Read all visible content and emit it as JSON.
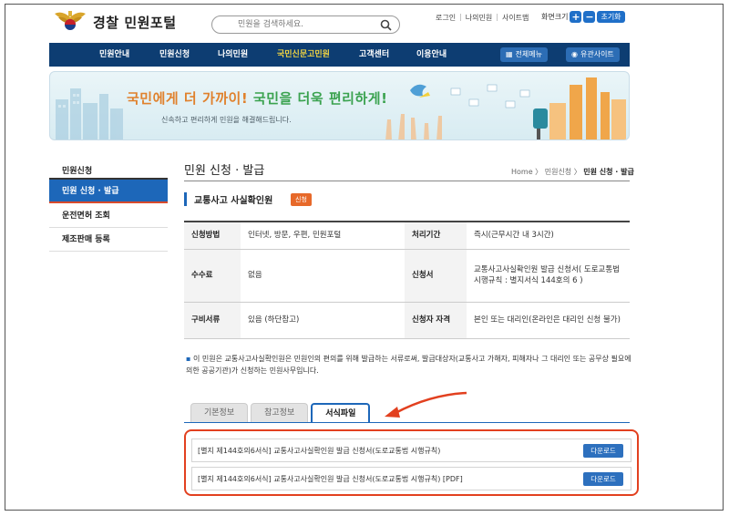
{
  "header": {
    "logo_text": "경찰 민원포털",
    "search_placeholder": "민원을 검색하세요.",
    "util_links": [
      "로그인",
      "나의민원",
      "사이트맵"
    ],
    "zoom_label": "화면크기",
    "zoom_in": "+",
    "zoom_out": "−",
    "zoom_reset": "초기화"
  },
  "nav": {
    "items": [
      "민원안내",
      "민원신청",
      "나의민원",
      "국민신문고민원",
      "고객센터",
      "이용안내"
    ],
    "active_index": 3,
    "all_menu": "전체메뉴",
    "related_sites": "유관사이트"
  },
  "banner": {
    "title_a": "국민에게 더 가까이!",
    "title_b": "국민을 더욱 편리하게!",
    "subtitle": "신속하고 편리하게 민원을 해결해드립니다."
  },
  "sidebar": {
    "title": "민원신청",
    "items": [
      "민원 신청 · 발급",
      "운전면허 조회",
      "제조판매 등록"
    ]
  },
  "page": {
    "title": "민원 신청 · 발급",
    "breadcrumb": [
      "Home",
      "민원신청",
      "민원 신청 · 발급"
    ],
    "section_title": "교통사고 사실확인원",
    "badge": "신청"
  },
  "info_table": {
    "method_label": "신청방법",
    "method_value": "인터넷, 방문, 우편, 민원포털",
    "period_label": "처리기간",
    "period_value": "즉시(근무시간 내 3시간)",
    "fee_label": "수수료",
    "fee_value": "없음",
    "form_label": "신청서",
    "form_value": "교통사고사실확인원 발급 신청서( 도로교통법 시행규칙 : 별지서식 144호의 6 )",
    "docs_label": "구비서류",
    "docs_value": "있음 (하단참고)",
    "qual_label": "신청자 자격",
    "qual_value": "본인 또는 대리인(온라인은 대리인 신청 불가)"
  },
  "note": "이 민원은 교통사고사실확인원은 민원인의 편의를 위해 발급하는 서류로써, 발급대상자(교통사고 가해자, 피해자나 그 대리인 또는 공무상 필요에 의한 공공기관)가 신청하는 민원사무입니다.",
  "tabs": {
    "items": [
      "기본정보",
      "참고정보",
      "서식파일"
    ],
    "active_index": 2
  },
  "files": [
    {
      "name": "[별지 제144호의6서식] 교통사고사실확인원 발급 신청서(도로교통법 시행규칙)",
      "button": "다운로드"
    },
    {
      "name": "[별지 제144호의6서식] 교통사고사실확인원 발급 신청서(도로교통법 시행규칙) [PDF]",
      "button": "다운로드"
    }
  ],
  "colors": {
    "nav_bg": "#0d3d72",
    "nav_active": "#f2d442",
    "accent_blue": "#1d67b9",
    "highlight_red": "#e2401f",
    "badge_orange": "#e7692a"
  }
}
